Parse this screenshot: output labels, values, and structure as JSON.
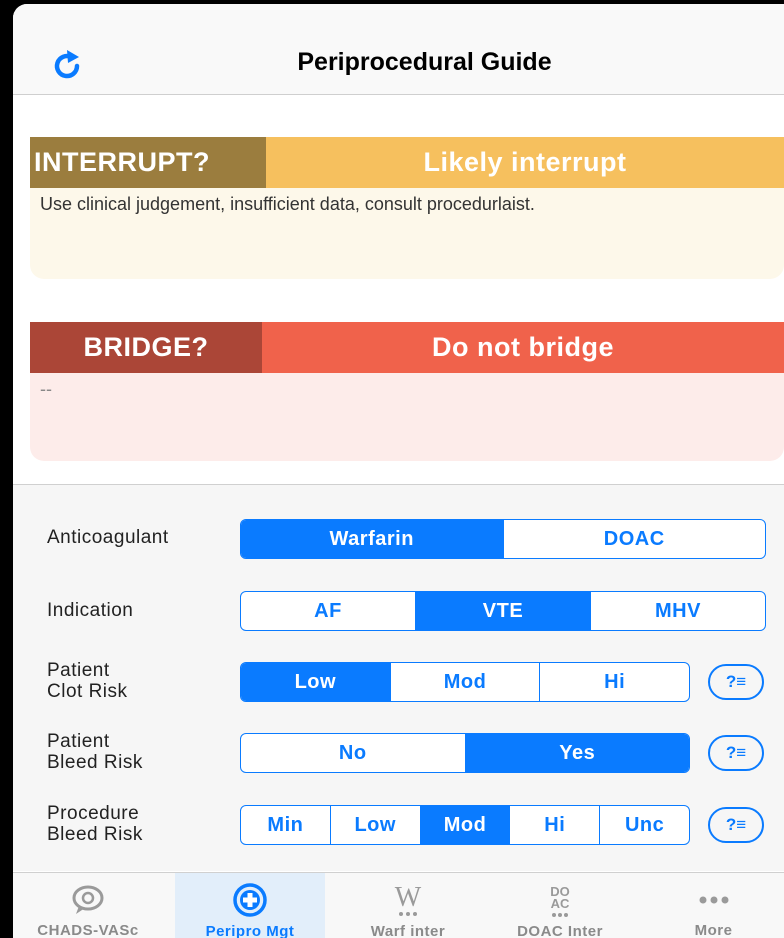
{
  "header": {
    "title": "Periprocedural Guide",
    "refresh_icon": "refresh-icon"
  },
  "interrupt": {
    "label": "INTERRUPT?",
    "value": "Likely interrupt",
    "note": "Use clinical judgement, insufficient data, consult procedurlaist.",
    "colors": {
      "label_bg": "#9b7d3e",
      "value_bg": "#f6c05e",
      "body_bg": "#fdf8ea"
    }
  },
  "bridge": {
    "label": "BRIDGE?",
    "value": "Do not bridge",
    "note": "--",
    "colors": {
      "label_bg": "#ab4637",
      "value_bg": "#f0624b",
      "body_bg": "#fdecea"
    }
  },
  "controls": {
    "anticoagulant": {
      "label": "Anticoagulant",
      "options": [
        "Warfarin",
        "DOAC"
      ],
      "selected": "Warfarin"
    },
    "indication": {
      "label": "Indication",
      "options": [
        "AF",
        "VTE",
        "MHV"
      ],
      "selected": "VTE"
    },
    "clot_risk": {
      "label_line1": "Patient",
      "label_line2": "Clot Risk",
      "options": [
        "Low",
        "Mod",
        "Hi"
      ],
      "selected": "Low",
      "help": "?≡"
    },
    "bleed_risk": {
      "label_line1": "Patient",
      "label_line2": "Bleed Risk",
      "options": [
        "No",
        "Yes"
      ],
      "selected": "Yes",
      "help": "?≡"
    },
    "procedure_bleed_risk": {
      "label_line1": "Procedure",
      "label_line2": "Bleed Risk",
      "options": [
        "Min",
        "Low",
        "Mod",
        "Hi",
        "Unc"
      ],
      "selected": "Mod",
      "help": "?≡"
    }
  },
  "tabs": [
    {
      "label": "CHADS-VASc",
      "icon": "chat-bubble-icon",
      "active": false
    },
    {
      "label": "Peripro Mgt",
      "icon": "medical-cross-icon",
      "active": true
    },
    {
      "label": "Warf inter",
      "icon": "w-letter-icon",
      "active": false
    },
    {
      "label": "DOAC Inter",
      "icon": "doac-icon",
      "active": false
    },
    {
      "label": "More",
      "icon": "more-dots-icon",
      "active": false
    }
  ],
  "colors": {
    "accent": "#0a7bff"
  }
}
